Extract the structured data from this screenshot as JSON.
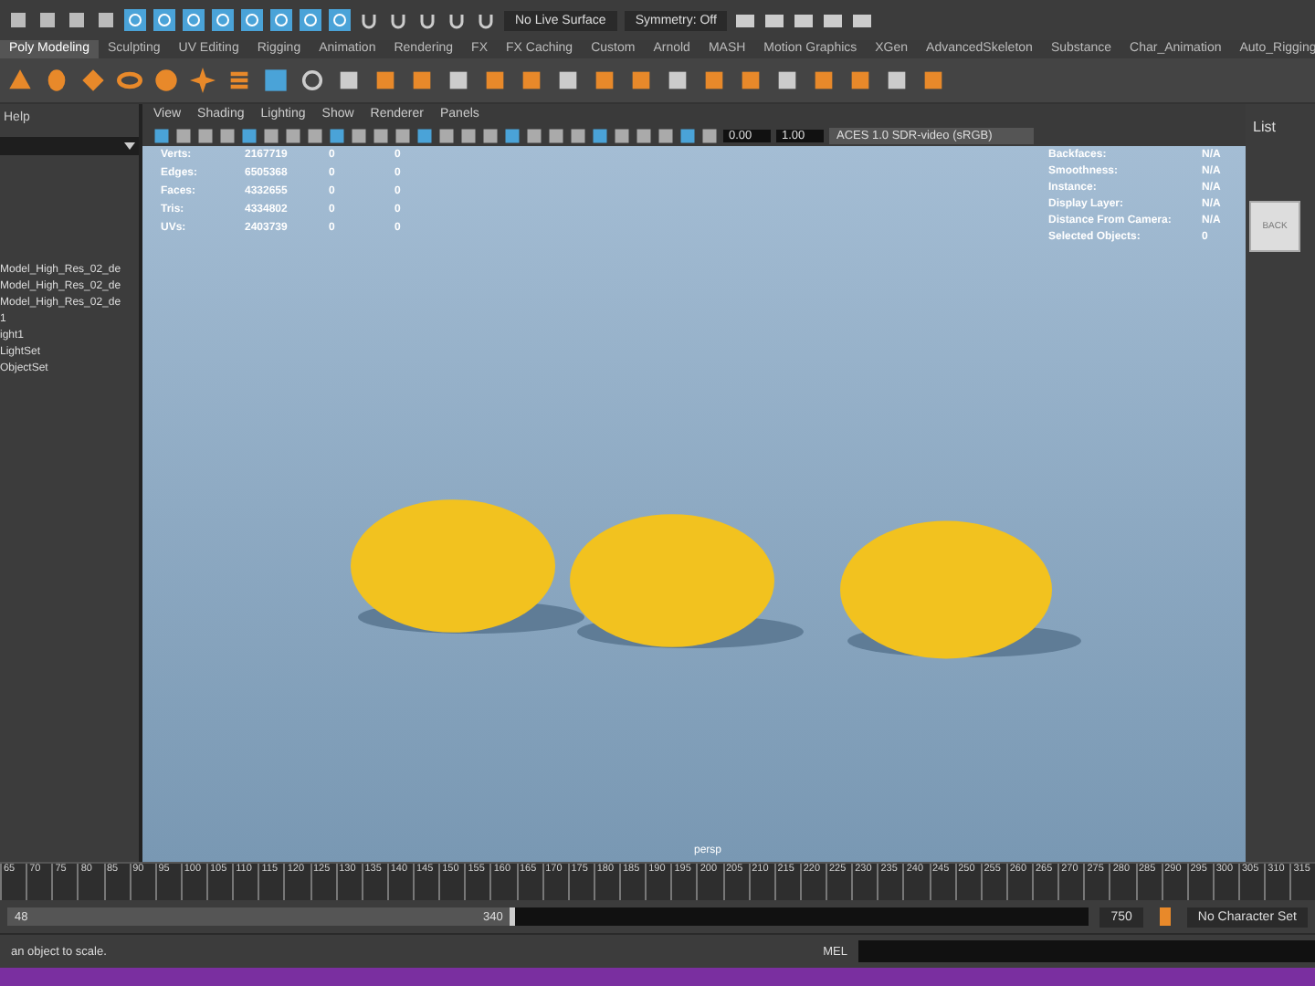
{
  "top_toolbar": {
    "live_surface": "No Live Surface",
    "symmetry": "Symmetry: Off"
  },
  "shelf_tabs": [
    {
      "label": "Poly Modeling",
      "selected": true
    },
    {
      "label": "Sculpting",
      "selected": false
    },
    {
      "label": "UV Editing",
      "selected": false
    },
    {
      "label": "Rigging",
      "selected": false
    },
    {
      "label": "Animation",
      "selected": false
    },
    {
      "label": "Rendering",
      "selected": false
    },
    {
      "label": "FX",
      "selected": false
    },
    {
      "label": "FX Caching",
      "selected": false
    },
    {
      "label": "Custom",
      "selected": false
    },
    {
      "label": "Arnold",
      "selected": false
    },
    {
      "label": "MASH",
      "selected": false
    },
    {
      "label": "Motion Graphics",
      "selected": false
    },
    {
      "label": "XGen",
      "selected": false
    },
    {
      "label": "AdvancedSkeleton",
      "selected": false
    },
    {
      "label": "Substance",
      "selected": false
    },
    {
      "label": "Char_Animation",
      "selected": false
    },
    {
      "label": "Auto_Rigging",
      "selected": false
    }
  ],
  "outliner": {
    "menu": "Help",
    "items": [
      "Model_High_Res_02_de",
      "Model_High_Res_02_de",
      "Model_High_Res_02_de",
      "1",
      "ight1",
      "LightSet",
      "ObjectSet"
    ]
  },
  "viewport": {
    "menus": [
      "View",
      "Shading",
      "Lighting",
      "Show",
      "Renderer",
      "Panels"
    ],
    "exposure": "0.00",
    "gamma": "1.00",
    "color_space": "ACES 1.0 SDR-video (sRGB)",
    "stats": [
      {
        "label": "Verts:",
        "values": [
          "2167719",
          "0",
          "0"
        ]
      },
      {
        "label": "Edges:",
        "values": [
          "6505368",
          "0",
          "0"
        ]
      },
      {
        "label": "Faces:",
        "values": [
          "4332655",
          "0",
          "0"
        ]
      },
      {
        "label": "Tris:",
        "values": [
          "4334802",
          "0",
          "0"
        ]
      },
      {
        "label": "UVs:",
        "values": [
          "2403739",
          "0",
          "0"
        ]
      }
    ],
    "info": [
      {
        "label": "Backfaces:",
        "value": "N/A"
      },
      {
        "label": "Smoothness:",
        "value": "N/A"
      },
      {
        "label": "Instance:",
        "value": "N/A"
      },
      {
        "label": "Display Layer:",
        "value": "N/A"
      },
      {
        "label": "Distance From Camera:",
        "value": "N/A"
      },
      {
        "label": "Selected Objects:",
        "value": "0"
      }
    ],
    "view_cube": "BACK",
    "camera": "persp"
  },
  "right_panel": {
    "label": "List"
  },
  "time_slider": {
    "ticks": [
      "65",
      "70",
      "75",
      "80",
      "85",
      "90",
      "95",
      "100",
      "105",
      "110",
      "115",
      "120",
      "125",
      "130",
      "135",
      "140",
      "145",
      "150",
      "155",
      "160",
      "165",
      "170",
      "175",
      "180",
      "185",
      "190",
      "195",
      "200",
      "205",
      "210",
      "215",
      "220",
      "225",
      "230",
      "235",
      "240",
      "245",
      "250",
      "255",
      "260",
      "265",
      "270",
      "275",
      "280",
      "285",
      "290",
      "295",
      "300",
      "305",
      "310",
      "315"
    ]
  },
  "range": {
    "level": 0.47,
    "start": "48",
    "end": "340",
    "total": "750",
    "character_set": "No Character Set"
  },
  "status": {
    "help": "an object to scale.",
    "command_label": "MEL"
  }
}
